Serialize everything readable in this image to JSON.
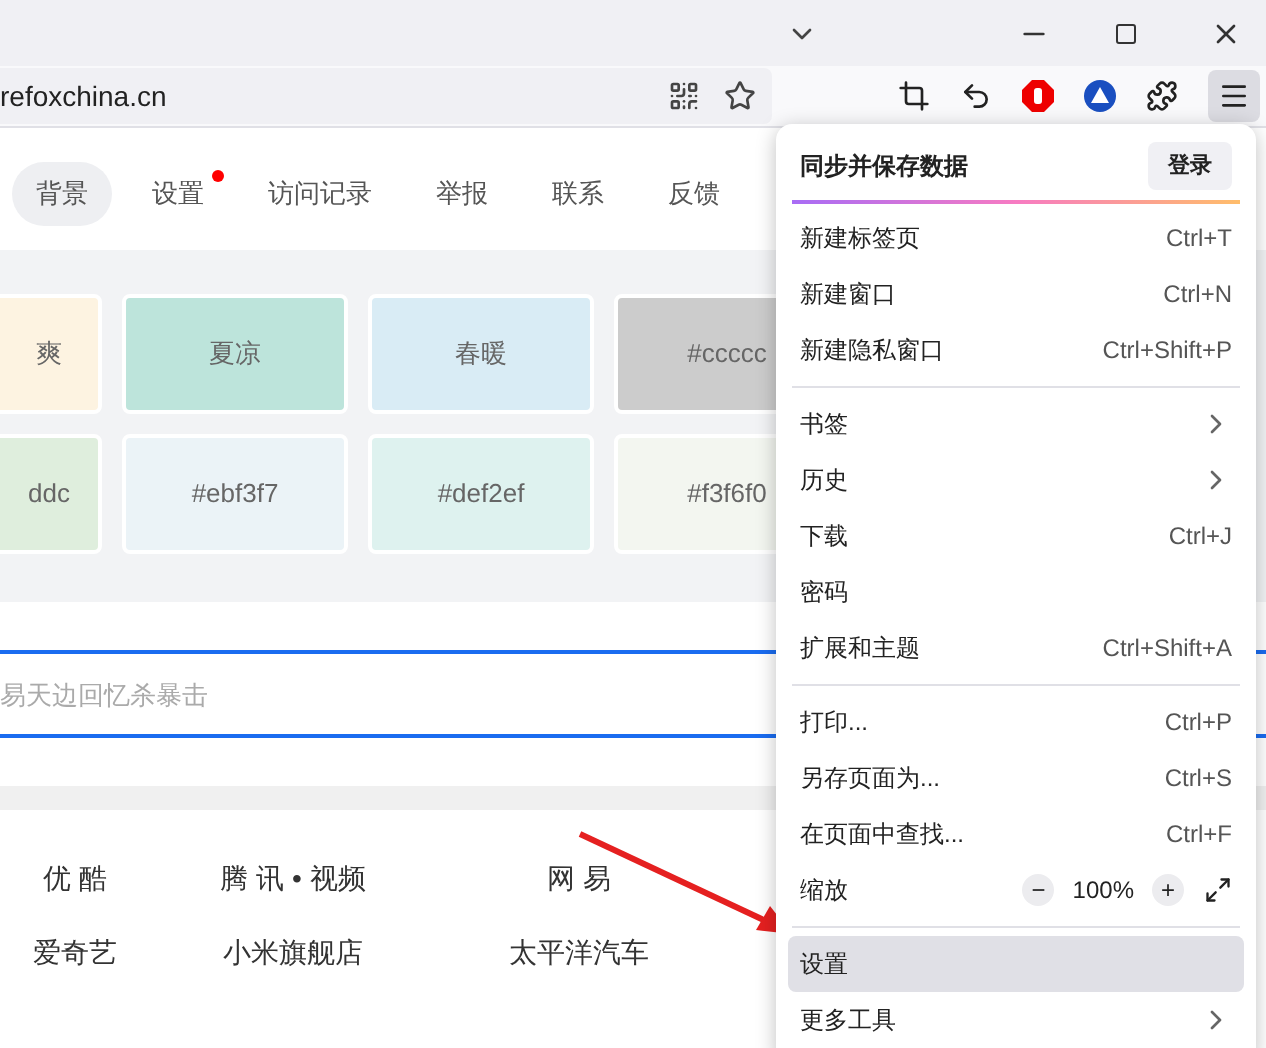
{
  "address_bar": {
    "url": "refoxchina.cn"
  },
  "tabs": [
    {
      "label": "背景",
      "selected": true,
      "dot": false
    },
    {
      "label": "设置",
      "selected": false,
      "dot": true
    },
    {
      "label": "访问记录",
      "selected": false,
      "dot": false
    },
    {
      "label": "举报",
      "selected": false,
      "dot": false
    },
    {
      "label": "联系",
      "selected": false,
      "dot": false
    },
    {
      "label": "反馈",
      "selected": false,
      "dot": false
    }
  ],
  "swatches": [
    [
      {
        "label": "爽",
        "color": "#fdf3e1"
      },
      {
        "label": "夏凉",
        "color": "#bde4db"
      },
      {
        "label": "春暖",
        "color": "#d9ecf5"
      },
      {
        "label": "#ccccc",
        "color": "#cccccc"
      }
    ],
    [
      {
        "label": "ddc",
        "color": "#dfeedd"
      },
      {
        "label": "#ebf3f7",
        "color": "#ebf3f7"
      },
      {
        "label": "#def2ef",
        "color": "#def2ef"
      },
      {
        "label": "#f3f6f0",
        "color": "#f3f6f0"
      }
    ]
  ],
  "search": {
    "placeholder": "易天边回忆杀暴击"
  },
  "links": [
    [
      "优 酷",
      "腾 讯 • 视频",
      "网 易"
    ],
    [
      "爱奇艺",
      "小米旗舰店",
      "太平洋汽车"
    ]
  ],
  "menu": {
    "sync_title": "同步并保存数据",
    "login": "登录",
    "items": [
      {
        "kind": "item",
        "label": "新建标签页",
        "shortcut": "Ctrl+T",
        "selected": false
      },
      {
        "kind": "item",
        "label": "新建窗口",
        "shortcut": "Ctrl+N",
        "selected": false
      },
      {
        "kind": "item",
        "label": "新建隐私窗口",
        "shortcut": "Ctrl+Shift+P",
        "selected": false
      },
      {
        "kind": "separator"
      },
      {
        "kind": "submenu",
        "label": "书签",
        "selected": false
      },
      {
        "kind": "submenu",
        "label": "历史",
        "selected": false
      },
      {
        "kind": "item",
        "label": "下载",
        "shortcut": "Ctrl+J",
        "selected": false
      },
      {
        "kind": "item",
        "label": "密码",
        "selected": false
      },
      {
        "kind": "item",
        "label": "扩展和主题",
        "shortcut": "Ctrl+Shift+A",
        "selected": false
      },
      {
        "kind": "separator"
      },
      {
        "kind": "item",
        "label": "打印...",
        "shortcut": "Ctrl+P",
        "selected": false
      },
      {
        "kind": "item",
        "label": "另存页面为...",
        "shortcut": "Ctrl+S",
        "selected": false
      },
      {
        "kind": "item",
        "label": "在页面中查找...",
        "shortcut": "Ctrl+F",
        "selected": false
      },
      {
        "kind": "zoom",
        "label": "缩放",
        "minus": "−",
        "value": "100%",
        "plus": "+"
      },
      {
        "kind": "separator"
      },
      {
        "kind": "item",
        "label": "设置",
        "selected": true
      },
      {
        "kind": "submenu",
        "label": "更多工具",
        "selected": false
      }
    ]
  }
}
